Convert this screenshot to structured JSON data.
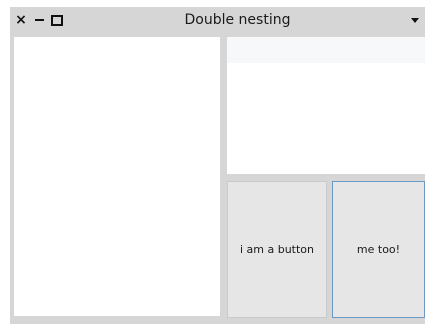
{
  "window": {
    "title": "Double nesting",
    "controls": {
      "close_icon": "close-icon",
      "minimize_icon": "minimize-icon",
      "maximize_icon": "maximize-icon",
      "menu_icon": "chevron-down-icon"
    }
  },
  "buttons": {
    "first_label": "i am a button",
    "second_label": "me too!"
  },
  "colors": {
    "window_bg": "#d6d6d6",
    "panel_bg": "#ffffff",
    "button_bg": "#e6e6e6",
    "focus_border": "#6d9ac4"
  }
}
